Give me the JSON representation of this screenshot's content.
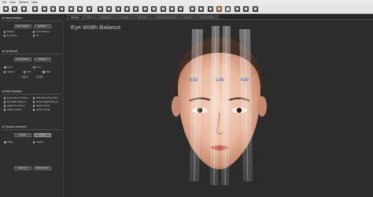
{
  "menu": [
    "File",
    "View",
    "Options",
    "Help"
  ],
  "toolbar_icons": [
    "open-icon",
    "save-icon",
    "folder-icon",
    "camera-icon",
    "undo-icon",
    "redo-icon",
    "select-icon",
    "move-icon",
    "rotate-icon",
    "scale-icon",
    "front-view-icon",
    "left-view-icon",
    "right-view-icon",
    "top-view-icon",
    "perspective-icon",
    "ortho-icon",
    "grid-icon",
    "axis-icon",
    "measure-icon",
    "landmark-icon",
    "mesh-icon",
    "texture-icon",
    "wireframe-icon",
    "face-icon",
    "light-icon",
    "settings-icon",
    "fullscreen-icon",
    "help-icon"
  ],
  "panel": {
    "head_position": {
      "title": "Head Position",
      "buttons": [
        "Auto Adjust",
        "Initialize"
      ],
      "options": [
        "Midline",
        "Orbit Midline",
        "Eye Plane",
        "FH"
      ]
    },
    "landmark": {
      "title": "Landmark",
      "buttons": [
        "Auto Detect",
        "Initialize"
      ],
      "options": [
        "Point",
        "Line",
        "Caption",
        "Grid",
        "Ratio"
      ],
      "toggles": [
        "On",
        "Off"
      ]
    },
    "face_analysis": {
      "title": "Face Analysis",
      "options": [
        "Symmetry & Volume",
        "Fifth Facial Proportion",
        "Eye Width Balance",
        "Facial Height Balance",
        "Depth Of Contour",
        "Depth Of Chin",
        "Lateral Levels",
        "Lateral Angle"
      ]
    },
    "virtual_landmark": {
      "title": "Virtual Landmark",
      "buttons": [
        "Locate",
        "Draw"
      ],
      "options": [
        "Vitals",
        "Caption"
      ]
    },
    "footer_buttons": [
      "Remove",
      "Remove All"
    ]
  },
  "tabs": [
    "3D View",
    "Face",
    "Expression",
    "Compare",
    "Symmetry",
    "Proportion Analysis",
    "3D View",
    "Cephalometry"
  ],
  "viewport": {
    "title": "Eye Width Balance",
    "readouts": [
      {
        "label": "33.0 mm",
        "ratio": "0.92"
      },
      {
        "label": "35.8 mm",
        "ratio": "1.00"
      },
      {
        "label": "30.6 mm",
        "ratio": "0.87"
      }
    ]
  },
  "colors": {
    "accent": "#4f7fe0",
    "panel_bg": "#2f2f2f",
    "viewport_bg": "#2c2c2c"
  }
}
